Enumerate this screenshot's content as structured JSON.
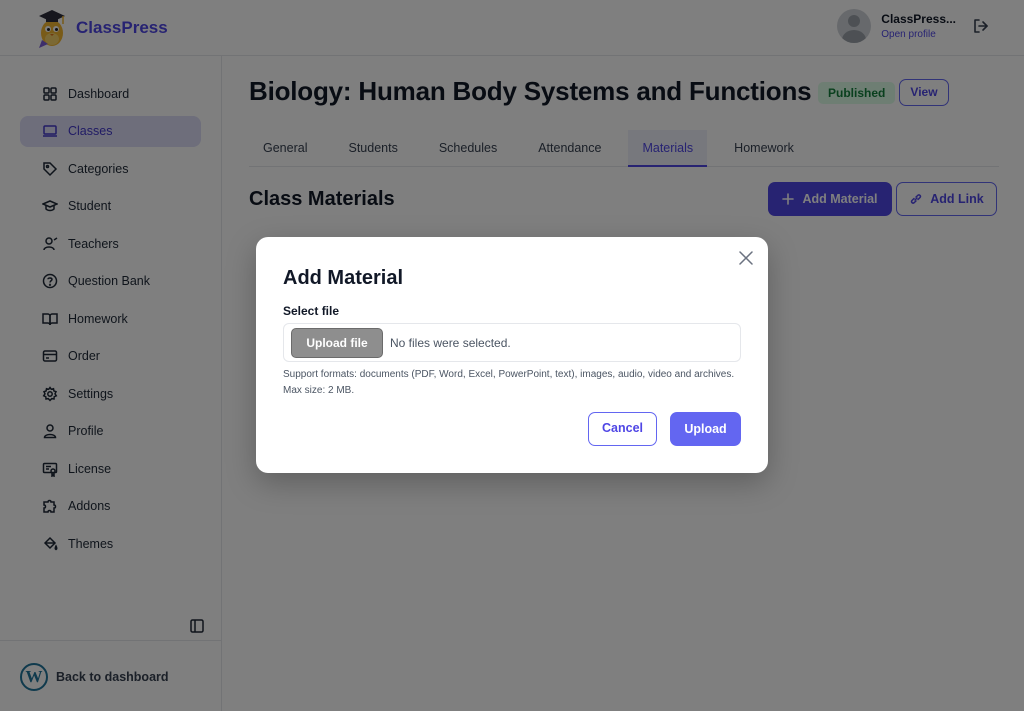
{
  "app": {
    "name": "ClassPress"
  },
  "user": {
    "name": "ClassPress...",
    "profile_link": "Open profile"
  },
  "sidebar": {
    "items": [
      {
        "label": "Dashboard",
        "icon": "grid-icon",
        "active": false
      },
      {
        "label": "Classes",
        "icon": "monitor-icon",
        "active": true
      },
      {
        "label": "Categories",
        "icon": "tag-icon",
        "active": false
      },
      {
        "label": "Student",
        "icon": "graduation-cap-icon",
        "active": false
      },
      {
        "label": "Teachers",
        "icon": "teacher-icon",
        "active": false
      },
      {
        "label": "Question Bank",
        "icon": "question-circle-icon",
        "active": false
      },
      {
        "label": "Homework",
        "icon": "book-open-icon",
        "active": false
      },
      {
        "label": "Order",
        "icon": "wallet-icon",
        "active": false
      },
      {
        "label": "Settings",
        "icon": "gear-icon",
        "active": false
      },
      {
        "label": "Profile",
        "icon": "user-icon",
        "active": false
      },
      {
        "label": "License",
        "icon": "license-icon",
        "active": false
      },
      {
        "label": "Addons",
        "icon": "puzzle-icon",
        "active": false
      },
      {
        "label": "Themes",
        "icon": "paint-bucket-icon",
        "active": false
      }
    ],
    "back_label": "Back to dashboard"
  },
  "page": {
    "title": "Biology: Human Body Systems and Functions",
    "status": "Published",
    "view_label": "View",
    "tabs": [
      {
        "label": "General",
        "active": false
      },
      {
        "label": "Students",
        "active": false
      },
      {
        "label": "Schedules",
        "active": false
      },
      {
        "label": "Attendance",
        "active": false
      },
      {
        "label": "Materials",
        "active": true
      },
      {
        "label": "Homework",
        "active": false
      }
    ],
    "section_title": "Class Materials",
    "add_material_label": "Add Material",
    "add_link_label": "Add Link"
  },
  "modal": {
    "title": "Add Material",
    "file_label": "Select file",
    "upload_file_label": "Upload file",
    "file_status": "No files were selected.",
    "help_text": "Support formats: documents (PDF, Word, Excel, PowerPoint, text), images, audio, video and archives. Max size: 2 MB.",
    "cancel_label": "Cancel",
    "upload_label": "Upload"
  },
  "colors": {
    "accent": "#4f46e5",
    "accent_light": "#6366f1",
    "published_bg": "#dcfce7",
    "published_text": "#15803d"
  }
}
